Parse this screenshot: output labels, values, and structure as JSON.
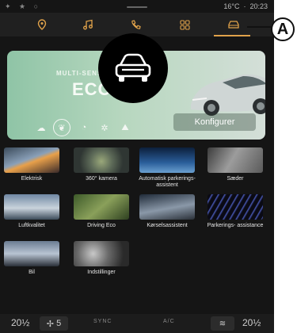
{
  "status_bar": {
    "left_icons": "✦ ★ ○",
    "temperature": "16°C",
    "clock": "20:23"
  },
  "nav": {
    "tabs": [
      {
        "name": "navigation",
        "icon": "map-pin-icon"
      },
      {
        "name": "music",
        "icon": "music-note-icon"
      },
      {
        "name": "phone",
        "icon": "phone-icon"
      },
      {
        "name": "apps",
        "icon": "apps-grid-icon"
      },
      {
        "name": "vehicle",
        "icon": "car-icon",
        "active": true
      }
    ],
    "accent_color": "#e0a24a"
  },
  "callout": {
    "letter": "A"
  },
  "hero": {
    "subtitle": "MULTI-SENS",
    "mode": "ECO",
    "configure_label": "Konfigurer",
    "mode_icons": [
      "cloud-icon",
      "leaf-icon",
      "speedometer-icon",
      "gear-icon",
      "mountain-icon"
    ],
    "selected_mode_index": 1
  },
  "grid": [
    {
      "label": "Elektrisk",
      "thumb": "electric-road"
    },
    {
      "label": "360° kamera",
      "thumb": "camera-360"
    },
    {
      "label": "Automatisk parkerings-assistent",
      "thumb": "auto-parking"
    },
    {
      "label": "Sæder",
      "thumb": "seats"
    },
    {
      "label": "Luftkvalitet",
      "thumb": "air-quality"
    },
    {
      "label": "Driving Eco",
      "thumb": "driving-eco"
    },
    {
      "label": "Kørselsassistent",
      "thumb": "driving-assist"
    },
    {
      "label": "Parkerings- assistance",
      "thumb": "parking-assist"
    },
    {
      "label": "Bil",
      "thumb": "car"
    },
    {
      "label": "Indstillinger",
      "thumb": "settings"
    }
  ],
  "bottom_bar": {
    "temp_left": "20½",
    "fan_level": "5",
    "sync_label": "SYNC",
    "ac_label": "A/C",
    "temp_right": "20½"
  }
}
